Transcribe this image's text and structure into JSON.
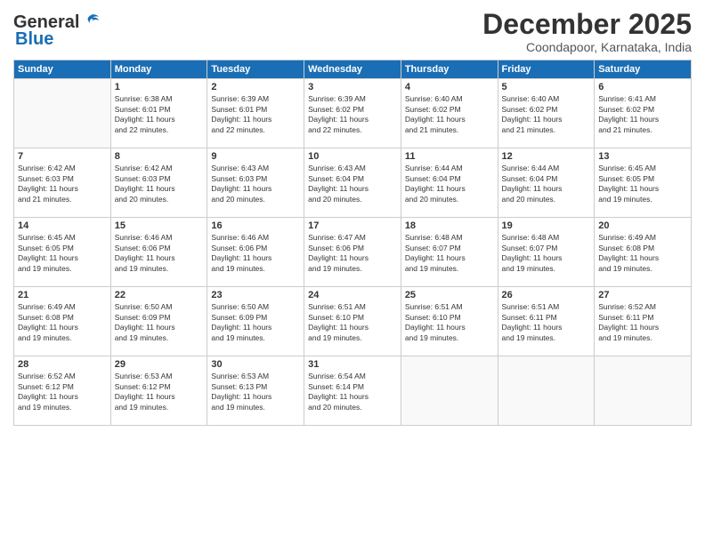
{
  "header": {
    "logo_line1": "General",
    "logo_line2": "Blue",
    "month": "December 2025",
    "location": "Coondapoor, Karnataka, India"
  },
  "days_of_week": [
    "Sunday",
    "Monday",
    "Tuesday",
    "Wednesday",
    "Thursday",
    "Friday",
    "Saturday"
  ],
  "weeks": [
    [
      {
        "day": "",
        "info": ""
      },
      {
        "day": "1",
        "info": "Sunrise: 6:38 AM\nSunset: 6:01 PM\nDaylight: 11 hours\nand 22 minutes."
      },
      {
        "day": "2",
        "info": "Sunrise: 6:39 AM\nSunset: 6:01 PM\nDaylight: 11 hours\nand 22 minutes."
      },
      {
        "day": "3",
        "info": "Sunrise: 6:39 AM\nSunset: 6:02 PM\nDaylight: 11 hours\nand 22 minutes."
      },
      {
        "day": "4",
        "info": "Sunrise: 6:40 AM\nSunset: 6:02 PM\nDaylight: 11 hours\nand 21 minutes."
      },
      {
        "day": "5",
        "info": "Sunrise: 6:40 AM\nSunset: 6:02 PM\nDaylight: 11 hours\nand 21 minutes."
      },
      {
        "day": "6",
        "info": "Sunrise: 6:41 AM\nSunset: 6:02 PM\nDaylight: 11 hours\nand 21 minutes."
      }
    ],
    [
      {
        "day": "7",
        "info": "Sunrise: 6:42 AM\nSunset: 6:03 PM\nDaylight: 11 hours\nand 21 minutes."
      },
      {
        "day": "8",
        "info": "Sunrise: 6:42 AM\nSunset: 6:03 PM\nDaylight: 11 hours\nand 20 minutes."
      },
      {
        "day": "9",
        "info": "Sunrise: 6:43 AM\nSunset: 6:03 PM\nDaylight: 11 hours\nand 20 minutes."
      },
      {
        "day": "10",
        "info": "Sunrise: 6:43 AM\nSunset: 6:04 PM\nDaylight: 11 hours\nand 20 minutes."
      },
      {
        "day": "11",
        "info": "Sunrise: 6:44 AM\nSunset: 6:04 PM\nDaylight: 11 hours\nand 20 minutes."
      },
      {
        "day": "12",
        "info": "Sunrise: 6:44 AM\nSunset: 6:04 PM\nDaylight: 11 hours\nand 20 minutes."
      },
      {
        "day": "13",
        "info": "Sunrise: 6:45 AM\nSunset: 6:05 PM\nDaylight: 11 hours\nand 19 minutes."
      }
    ],
    [
      {
        "day": "14",
        "info": "Sunrise: 6:45 AM\nSunset: 6:05 PM\nDaylight: 11 hours\nand 19 minutes."
      },
      {
        "day": "15",
        "info": "Sunrise: 6:46 AM\nSunset: 6:06 PM\nDaylight: 11 hours\nand 19 minutes."
      },
      {
        "day": "16",
        "info": "Sunrise: 6:46 AM\nSunset: 6:06 PM\nDaylight: 11 hours\nand 19 minutes."
      },
      {
        "day": "17",
        "info": "Sunrise: 6:47 AM\nSunset: 6:06 PM\nDaylight: 11 hours\nand 19 minutes."
      },
      {
        "day": "18",
        "info": "Sunrise: 6:48 AM\nSunset: 6:07 PM\nDaylight: 11 hours\nand 19 minutes."
      },
      {
        "day": "19",
        "info": "Sunrise: 6:48 AM\nSunset: 6:07 PM\nDaylight: 11 hours\nand 19 minutes."
      },
      {
        "day": "20",
        "info": "Sunrise: 6:49 AM\nSunset: 6:08 PM\nDaylight: 11 hours\nand 19 minutes."
      }
    ],
    [
      {
        "day": "21",
        "info": "Sunrise: 6:49 AM\nSunset: 6:08 PM\nDaylight: 11 hours\nand 19 minutes."
      },
      {
        "day": "22",
        "info": "Sunrise: 6:50 AM\nSunset: 6:09 PM\nDaylight: 11 hours\nand 19 minutes."
      },
      {
        "day": "23",
        "info": "Sunrise: 6:50 AM\nSunset: 6:09 PM\nDaylight: 11 hours\nand 19 minutes."
      },
      {
        "day": "24",
        "info": "Sunrise: 6:51 AM\nSunset: 6:10 PM\nDaylight: 11 hours\nand 19 minutes."
      },
      {
        "day": "25",
        "info": "Sunrise: 6:51 AM\nSunset: 6:10 PM\nDaylight: 11 hours\nand 19 minutes."
      },
      {
        "day": "26",
        "info": "Sunrise: 6:51 AM\nSunset: 6:11 PM\nDaylight: 11 hours\nand 19 minutes."
      },
      {
        "day": "27",
        "info": "Sunrise: 6:52 AM\nSunset: 6:11 PM\nDaylight: 11 hours\nand 19 minutes."
      }
    ],
    [
      {
        "day": "28",
        "info": "Sunrise: 6:52 AM\nSunset: 6:12 PM\nDaylight: 11 hours\nand 19 minutes."
      },
      {
        "day": "29",
        "info": "Sunrise: 6:53 AM\nSunset: 6:12 PM\nDaylight: 11 hours\nand 19 minutes."
      },
      {
        "day": "30",
        "info": "Sunrise: 6:53 AM\nSunset: 6:13 PM\nDaylight: 11 hours\nand 19 minutes."
      },
      {
        "day": "31",
        "info": "Sunrise: 6:54 AM\nSunset: 6:14 PM\nDaylight: 11 hours\nand 20 minutes."
      },
      {
        "day": "",
        "info": ""
      },
      {
        "day": "",
        "info": ""
      },
      {
        "day": "",
        "info": ""
      }
    ]
  ]
}
